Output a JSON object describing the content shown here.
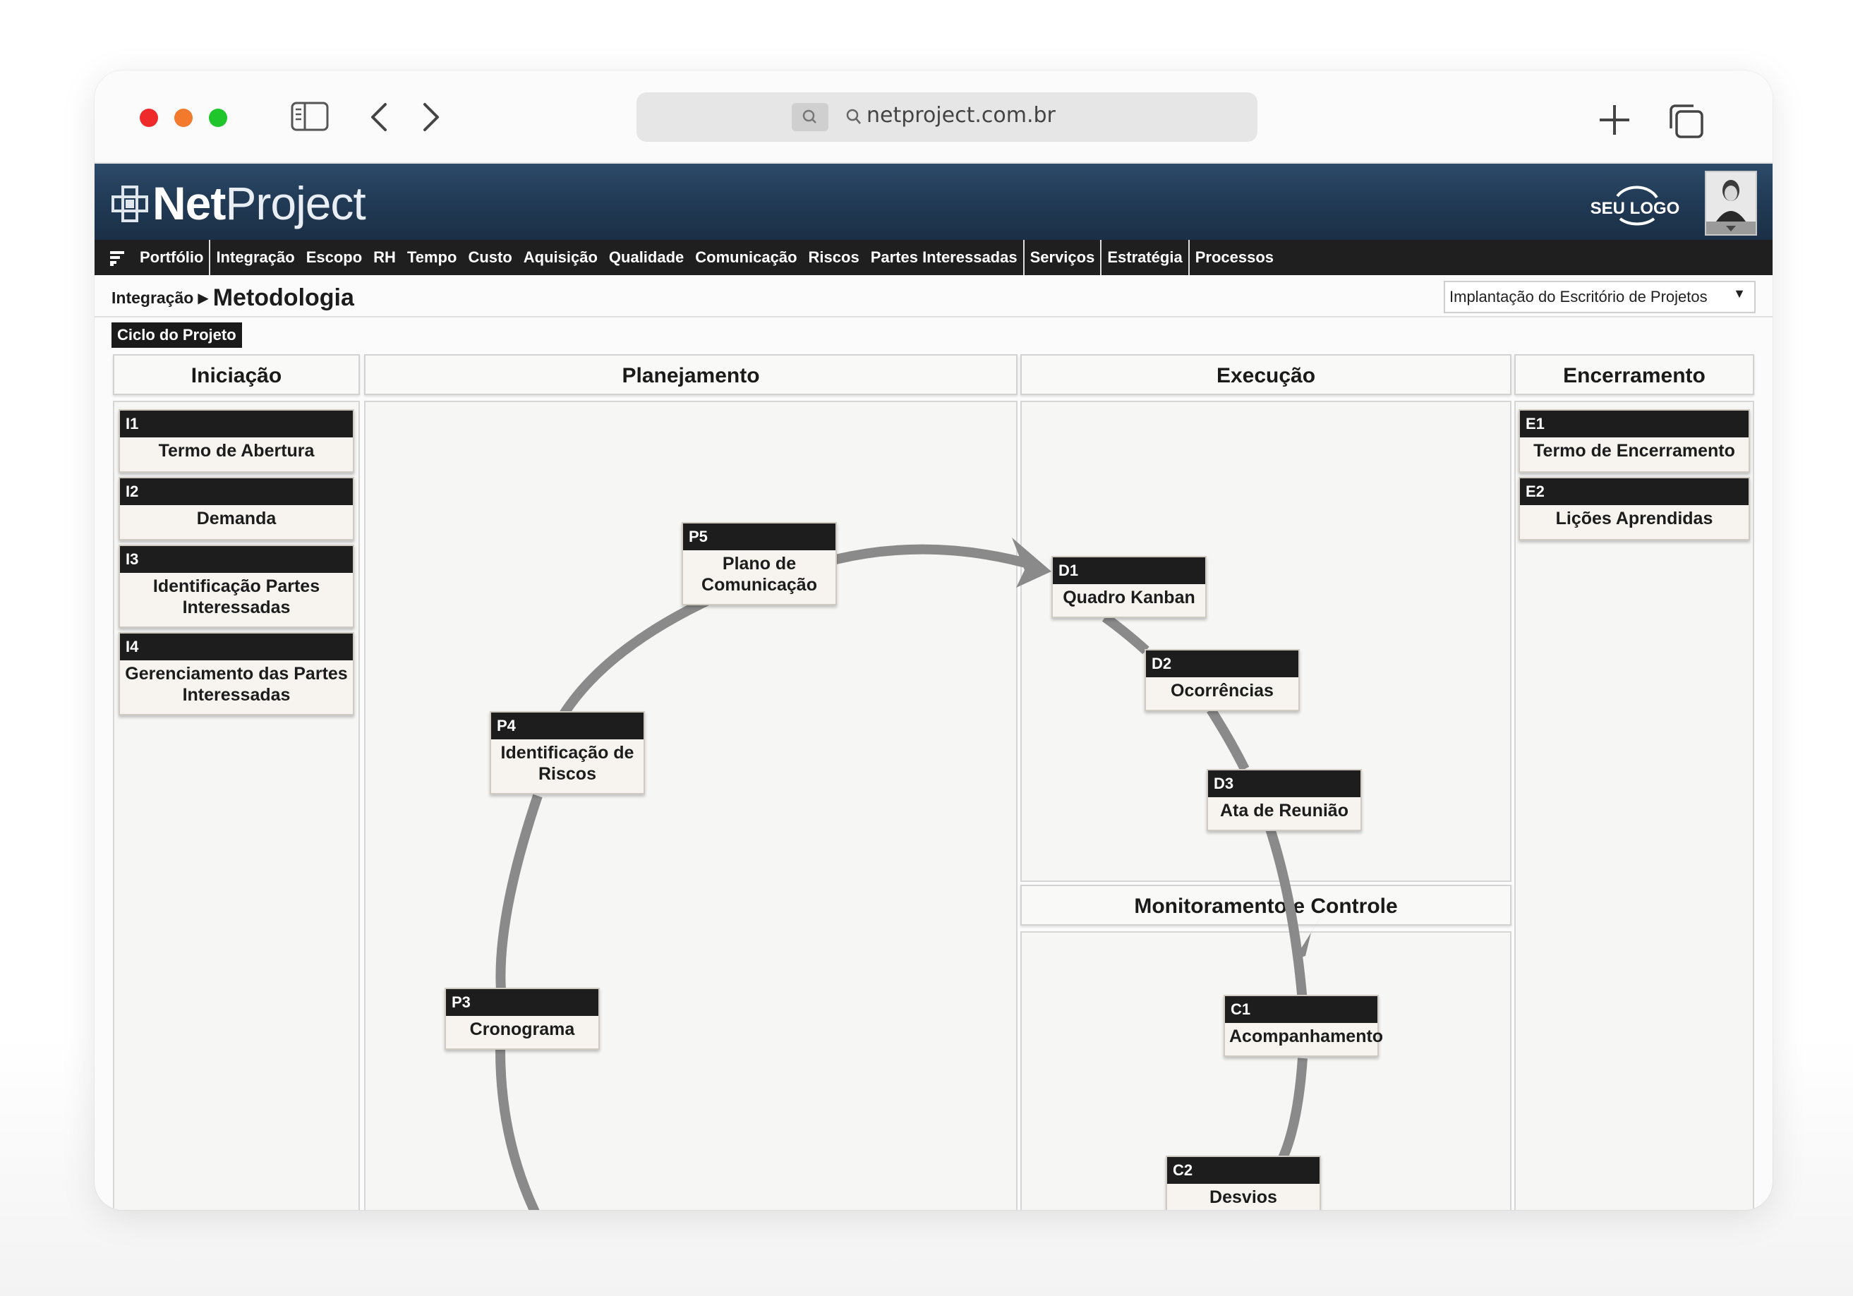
{
  "browser": {
    "url": "netproject.com.br",
    "icons": [
      "sidebar-toggle-icon",
      "back-icon",
      "forward-icon",
      "search-icon",
      "new-tab-icon",
      "tabs-overview-icon"
    ]
  },
  "header": {
    "logo_bold": "Net",
    "logo_light": "Project",
    "client_logo": "SEU LOGO"
  },
  "nav": {
    "items": [
      "Portfólio",
      "Integração",
      "Escopo",
      "RH",
      "Tempo",
      "Custo",
      "Aquisição",
      "Qualidade",
      "Comunicação",
      "Riscos",
      "Partes Interessadas",
      "Serviços",
      "Estratégia",
      "Processos"
    ]
  },
  "breadcrumb": {
    "parent": "Integração",
    "current": "Metodologia"
  },
  "project_select": {
    "value": "Implantação do Escritório de Projetos"
  },
  "cycle_tag": "Ciclo do Projeto",
  "columns": {
    "iniciacao": "Iniciação",
    "planejamento": "Planejamento",
    "execucao": "Execução",
    "encerramento": "Encerramento",
    "monitoramento": "Monitoramento e Controle"
  },
  "cards": {
    "i1": {
      "code": "I1",
      "title": "Termo de Abertura"
    },
    "i2": {
      "code": "I2",
      "title": "Demanda"
    },
    "i3": {
      "code": "I3",
      "title": "Identificação Partes Interessadas"
    },
    "i4": {
      "code": "I4",
      "title": "Gerenciamento das Partes Interessadas"
    },
    "p5": {
      "code": "P5",
      "title": "Plano de Comunicação"
    },
    "p4": {
      "code": "P4",
      "title": "Identificação de Riscos"
    },
    "p3": {
      "code": "P3",
      "title": "Cronograma"
    },
    "d1": {
      "code": "D1",
      "title": "Quadro Kanban"
    },
    "d2": {
      "code": "D2",
      "title": "Ocorrências"
    },
    "d3": {
      "code": "D3",
      "title": "Ata de Reunião"
    },
    "c1": {
      "code": "C1",
      "title": "Acompanhamento"
    },
    "c2": {
      "code": "C2",
      "title": "Desvios"
    },
    "e1": {
      "code": "E1",
      "title": "Termo de Encerramento"
    },
    "e2": {
      "code": "E2",
      "title": "Lições Aprendidas"
    }
  },
  "colors": {
    "header_blue": "#213a55",
    "nav_dark": "#1f1f1f",
    "card_header": "#1d1d1d",
    "flow_arrow": "#8a8a8a"
  }
}
